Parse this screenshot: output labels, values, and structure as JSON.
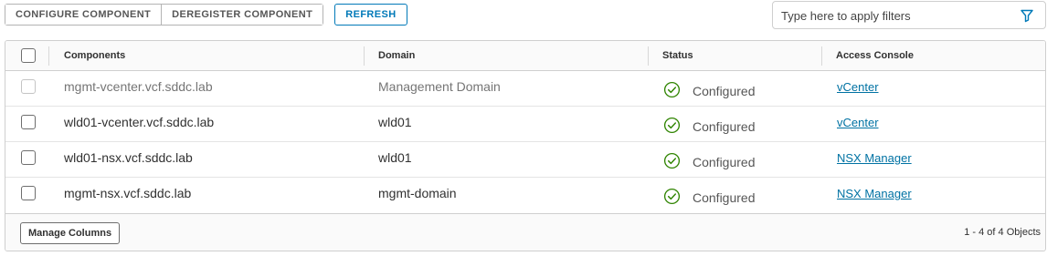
{
  "toolbar": {
    "configure_label": "CONFIGURE COMPONENT",
    "deregister_label": "DEREGISTER COMPONENT",
    "refresh_label": "REFRESH"
  },
  "filter": {
    "placeholder": "Type here to apply filters",
    "icon": "filter-icon"
  },
  "grid": {
    "columns": [
      "Components",
      "Domain",
      "Status",
      "Access Console"
    ],
    "rows": [
      {
        "component": "mgmt-vcenter.vcf.sddc.lab",
        "domain": "Management Domain",
        "status": "Configured",
        "console": "vCenter",
        "disabled": true
      },
      {
        "component": "wld01-vcenter.vcf.sddc.lab",
        "domain": "wld01",
        "status": "Configured",
        "console": "vCenter",
        "disabled": false
      },
      {
        "component": "wld01-nsx.vcf.sddc.lab",
        "domain": "wld01",
        "status": "Configured",
        "console": "NSX Manager",
        "disabled": false
      },
      {
        "component": "mgmt-nsx.vcf.sddc.lab",
        "domain": "mgmt-domain",
        "status": "Configured",
        "console": "NSX Manager",
        "disabled": false
      }
    ],
    "footer": {
      "manage_columns_label": "Manage Columns",
      "count_text": "1 - 4 of 4 Objects"
    }
  },
  "colors": {
    "accent": "#0079b8",
    "link": "#0072a3",
    "success": "#2f8400"
  }
}
